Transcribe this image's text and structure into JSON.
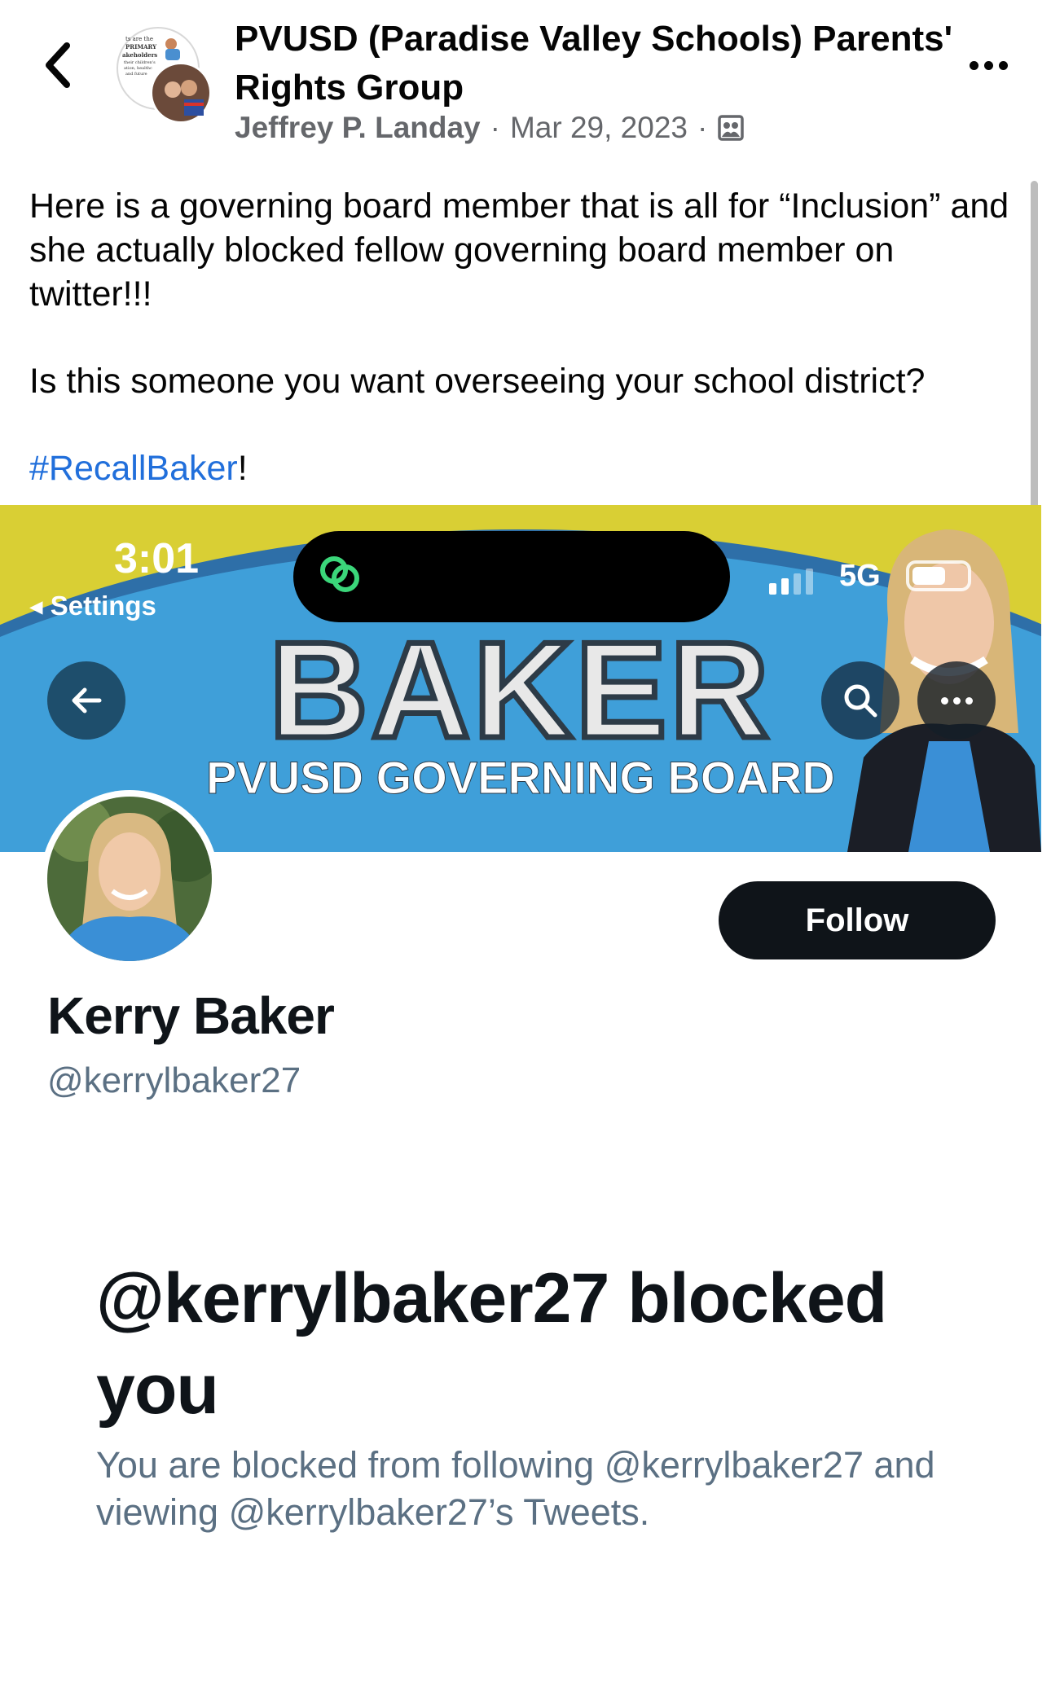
{
  "post_header": {
    "group_name": "PVUSD (Paradise Valley Schools) Parents' Rights Group",
    "author": "Jeffrey P. Landay",
    "separator": "·",
    "date": "Mar 29, 2023",
    "audience_icon": "members-only-group-icon",
    "back_icon": "chevron-left-icon",
    "more_icon": "more-horizontal-icon",
    "group_avatar_text": [
      "ts are the",
      "PRIMARY",
      "akeholders",
      "their children's",
      "ation, healthc",
      "and future"
    ]
  },
  "post": {
    "line1": "Here is a governing board member that is all for “Inclusion” and she actually blocked fellow governing board member on twitter!!!",
    "line2": "Is this someone you want overseeing your school district?",
    "hashtag": "#RecallBaker",
    "hashtag_suffix": "!"
  },
  "screenshot": {
    "status_bar": {
      "time": "3:01",
      "back_label": "◂ Settings",
      "network": "5G"
    },
    "banner": {
      "title": "BAKER",
      "subtitle": "PVUSD GOVERNING BOARD"
    },
    "profile": {
      "follow_label": "Follow",
      "display_name": "Kerry Baker",
      "handle": "@kerrylbaker27"
    },
    "blocked": {
      "title": "@kerrylbaker27 blocked you",
      "description": "You are blocked from following @kerrylbaker27 and viewing @kerrylbaker27’s Tweets."
    }
  },
  "colors": {
    "hashtag": "#216fdb",
    "meta_text": "#65676b",
    "banner_yellow": "#d9cf34",
    "banner_blue": "#3f9fd9",
    "follow_button": "#0f1419",
    "muted_text": "#5b7083"
  }
}
